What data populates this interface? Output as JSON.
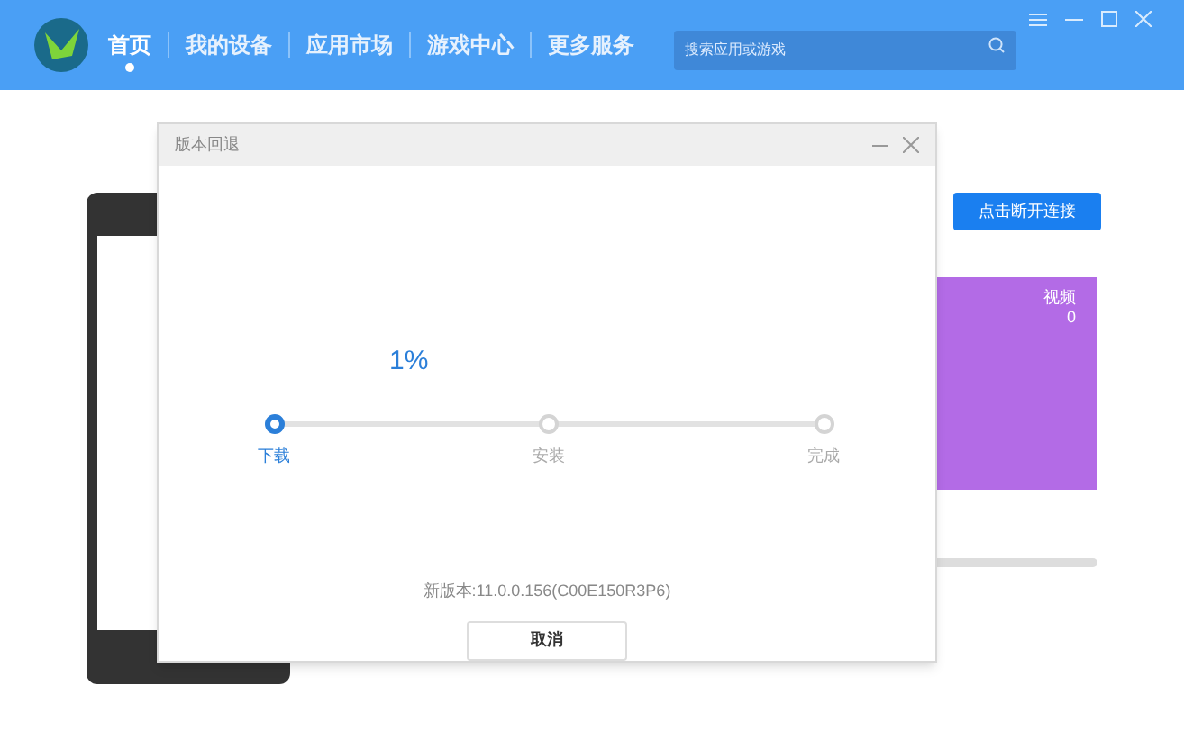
{
  "nav": {
    "items": [
      {
        "label": "首页",
        "selected": true
      },
      {
        "label": "我的设备",
        "selected": false
      },
      {
        "label": "应用市场",
        "selected": false
      },
      {
        "label": "游戏中心",
        "selected": false
      },
      {
        "label": "更多服务",
        "selected": false
      }
    ],
    "search": {
      "placeholder": "搜索应用或游戏"
    }
  },
  "background": {
    "connect_button": "点击断开连接",
    "card_text": [
      "视频",
      "0"
    ]
  },
  "dialog": {
    "title": "版本回退",
    "progress": {
      "reading": "1%",
      "level": 0.01
    },
    "steps": [
      {
        "label": "下载",
        "selected": true
      },
      {
        "label": "安装",
        "selected": false
      },
      {
        "label": "完成",
        "selected": false
      }
    ],
    "version": "新版本:11.0.0.156(C00E150R3P6)",
    "cancel": "取消"
  }
}
